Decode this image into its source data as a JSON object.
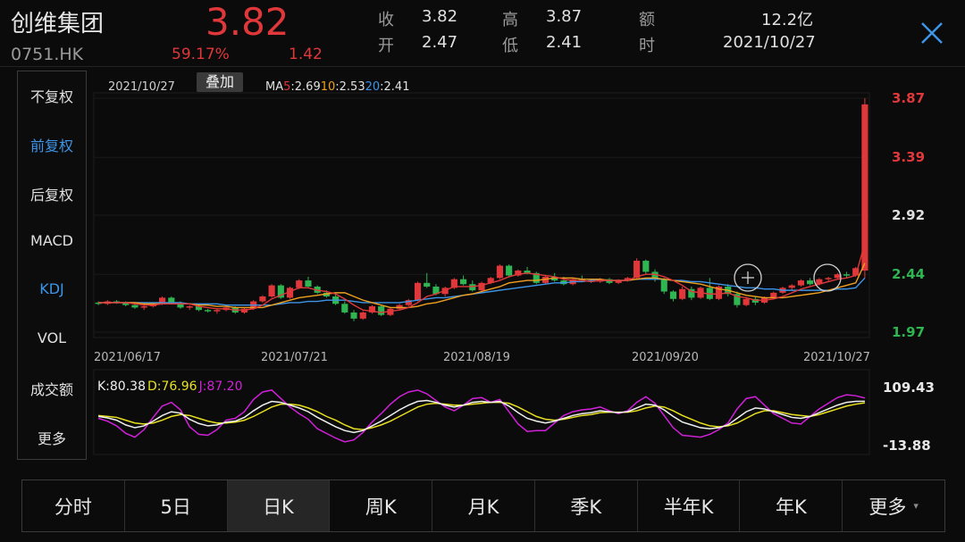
{
  "header": {
    "name": "创维集团",
    "code": "0751.HK",
    "price": "3.82",
    "change_pct": "59.17%",
    "change": "1.42",
    "quotes": [
      {
        "label": "收",
        "value": "3.82"
      },
      {
        "label": "开",
        "value": "2.47"
      },
      {
        "label": "高",
        "value": "3.87"
      },
      {
        "label": "低",
        "value": "2.41"
      },
      {
        "label": "额",
        "value": "12.2亿"
      },
      {
        "label": "时",
        "value": "2021/10/27"
      }
    ],
    "colors": {
      "up": "#e0383a",
      "down": "#2fb551",
      "accent": "#3d95e8",
      "background": "#0b0b0b"
    }
  },
  "left_menu": [
    {
      "label": "不复权",
      "active": false
    },
    {
      "label": "前复权",
      "active": true
    },
    {
      "label": "后复权",
      "active": false
    },
    {
      "label": "MACD",
      "active": false
    },
    {
      "label": "KDJ",
      "active": true
    },
    {
      "label": "VOL",
      "active": false
    },
    {
      "label": "成交额",
      "active": false
    },
    {
      "label": "更多",
      "active": false
    }
  ],
  "chart": {
    "date": "2021/10/27",
    "overlay_button": "叠加",
    "ma": [
      {
        "prefix": "MA",
        "period": "5",
        "value": ":2.69",
        "color": "#e0383a"
      },
      {
        "prefix": "",
        "period": "10",
        "value": ":2.53",
        "color": "#f0a020"
      },
      {
        "prefix": "",
        "period": "20",
        "value": ":2.41",
        "color": "#3d95e8"
      }
    ],
    "kdj_labels": {
      "k": "K:80.38",
      "d": "D:76.96",
      "j": "J:87.20"
    }
  },
  "chart_data": [
    {
      "type": "candlestick",
      "title": "",
      "x_labels": [
        "2021/06/17",
        "2021/07/21",
        "2021/08/19",
        "2021/09/20",
        "2021/10/27"
      ],
      "y_ticks": [
        "3.87",
        "3.39",
        "2.92",
        "2.44",
        "1.97"
      ],
      "ylim": [
        1.97,
        3.87
      ],
      "candles": [
        [
          2.21,
          2.22,
          2.19,
          2.2
        ],
        [
          2.2,
          2.23,
          2.19,
          2.22
        ],
        [
          2.22,
          2.23,
          2.2,
          2.21
        ],
        [
          2.21,
          2.22,
          2.18,
          2.19
        ],
        [
          2.19,
          2.2,
          2.16,
          2.17
        ],
        [
          2.17,
          2.19,
          2.15,
          2.18
        ],
        [
          2.18,
          2.21,
          2.17,
          2.2
        ],
        [
          2.2,
          2.26,
          2.19,
          2.25
        ],
        [
          2.25,
          2.26,
          2.2,
          2.21
        ],
        [
          2.21,
          2.22,
          2.16,
          2.17
        ],
        [
          2.17,
          2.19,
          2.15,
          2.18
        ],
        [
          2.18,
          2.2,
          2.14,
          2.15
        ],
        [
          2.15,
          2.16,
          2.13,
          2.14
        ],
        [
          2.14,
          2.16,
          2.12,
          2.15
        ],
        [
          2.15,
          2.18,
          2.14,
          2.17
        ],
        [
          2.17,
          2.18,
          2.12,
          2.13
        ],
        [
          2.13,
          2.17,
          2.12,
          2.16
        ],
        [
          2.16,
          2.23,
          2.15,
          2.22
        ],
        [
          2.22,
          2.27,
          2.21,
          2.26
        ],
        [
          2.26,
          2.36,
          2.25,
          2.35
        ],
        [
          2.35,
          2.36,
          2.24,
          2.25
        ],
        [
          2.25,
          2.34,
          2.24,
          2.33
        ],
        [
          2.33,
          2.4,
          2.32,
          2.39
        ],
        [
          2.39,
          2.42,
          2.33,
          2.34
        ],
        [
          2.34,
          2.35,
          2.28,
          2.29
        ],
        [
          2.29,
          2.31,
          2.25,
          2.26
        ],
        [
          2.26,
          2.28,
          2.19,
          2.2
        ],
        [
          2.2,
          2.22,
          2.12,
          2.13
        ],
        [
          2.13,
          2.15,
          2.06,
          2.08
        ],
        [
          2.08,
          2.14,
          2.07,
          2.13
        ],
        [
          2.13,
          2.19,
          2.12,
          2.18
        ],
        [
          2.18,
          2.19,
          2.1,
          2.11
        ],
        [
          2.11,
          2.17,
          2.1,
          2.16
        ],
        [
          2.16,
          2.2,
          2.15,
          2.19
        ],
        [
          2.19,
          2.24,
          2.18,
          2.23
        ],
        [
          2.23,
          2.38,
          2.22,
          2.37
        ],
        [
          2.37,
          2.45,
          2.33,
          2.34
        ],
        [
          2.34,
          2.36,
          2.27,
          2.28
        ],
        [
          2.28,
          2.34,
          2.26,
          2.33
        ],
        [
          2.33,
          2.41,
          2.32,
          2.4
        ],
        [
          2.4,
          2.43,
          2.35,
          2.36
        ],
        [
          2.36,
          2.39,
          2.3,
          2.31
        ],
        [
          2.31,
          2.38,
          2.3,
          2.37
        ],
        [
          2.37,
          2.42,
          2.36,
          2.41
        ],
        [
          2.41,
          2.52,
          2.4,
          2.51
        ],
        [
          2.51,
          2.52,
          2.42,
          2.43
        ],
        [
          2.43,
          2.48,
          2.42,
          2.47
        ],
        [
          2.47,
          2.5,
          2.44,
          2.45
        ],
        [
          2.45,
          2.46,
          2.36,
          2.37
        ],
        [
          2.37,
          2.43,
          2.36,
          2.42
        ],
        [
          2.42,
          2.45,
          2.38,
          2.39
        ],
        [
          2.39,
          2.42,
          2.35,
          2.36
        ],
        [
          2.36,
          2.41,
          2.35,
          2.4
        ],
        [
          2.4,
          2.43,
          2.38,
          2.39
        ],
        [
          2.39,
          2.4,
          2.37,
          2.38
        ],
        [
          2.38,
          2.41,
          2.37,
          2.4
        ],
        [
          2.4,
          2.41,
          2.36,
          2.37
        ],
        [
          2.37,
          2.4,
          2.36,
          2.39
        ],
        [
          2.39,
          2.42,
          2.38,
          2.41
        ],
        [
          2.41,
          2.57,
          2.4,
          2.55
        ],
        [
          2.55,
          2.56,
          2.44,
          2.46
        ],
        [
          2.46,
          2.48,
          2.38,
          2.4
        ],
        [
          2.4,
          2.41,
          2.28,
          2.3
        ],
        [
          2.3,
          2.31,
          2.22,
          2.24
        ],
        [
          2.24,
          2.34,
          2.23,
          2.32
        ],
        [
          2.32,
          2.34,
          2.23,
          2.25
        ],
        [
          2.25,
          2.34,
          2.24,
          2.33
        ],
        [
          2.33,
          2.41,
          2.23,
          2.24
        ],
        [
          2.24,
          2.35,
          2.23,
          2.34
        ],
        [
          2.34,
          2.36,
          2.26,
          2.28
        ],
        [
          2.28,
          2.3,
          2.17,
          2.19
        ],
        [
          2.19,
          2.25,
          2.18,
          2.24
        ],
        [
          2.24,
          2.26,
          2.19,
          2.21
        ],
        [
          2.21,
          2.26,
          2.2,
          2.25
        ],
        [
          2.25,
          2.3,
          2.24,
          2.29
        ],
        [
          2.29,
          2.34,
          2.28,
          2.33
        ],
        [
          2.33,
          2.36,
          2.31,
          2.35
        ],
        [
          2.35,
          2.4,
          2.34,
          2.39
        ],
        [
          2.39,
          2.41,
          2.35,
          2.36
        ],
        [
          2.36,
          2.41,
          2.35,
          2.4
        ],
        [
          2.4,
          2.42,
          2.38,
          2.41
        ],
        [
          2.41,
          2.45,
          2.4,
          2.44
        ],
        [
          2.44,
          2.46,
          2.41,
          2.43
        ],
        [
          2.43,
          2.5,
          2.42,
          2.49
        ],
        [
          2.47,
          3.87,
          2.41,
          3.82
        ]
      ],
      "ma5": [
        2.21,
        2.21,
        2.21,
        2.21,
        2.2,
        2.19,
        2.19,
        2.2,
        2.2,
        2.2,
        2.2,
        2.18,
        2.17,
        2.16,
        2.16,
        2.15,
        2.15,
        2.16,
        2.19,
        2.24,
        2.27,
        2.3,
        2.33,
        2.33,
        2.31,
        2.3,
        2.28,
        2.24,
        2.19,
        2.15,
        2.14,
        2.13,
        2.14,
        2.15,
        2.17,
        2.21,
        2.26,
        2.28,
        2.31,
        2.34,
        2.34,
        2.34,
        2.35,
        2.37,
        2.39,
        2.42,
        2.44,
        2.45,
        2.44,
        2.43,
        2.42,
        2.4,
        2.39,
        2.39,
        2.38,
        2.39,
        2.39,
        2.39,
        2.39,
        2.42,
        2.44,
        2.44,
        2.42,
        2.39,
        2.35,
        2.3,
        2.29,
        2.28,
        2.28,
        2.29,
        2.26,
        2.25,
        2.23,
        2.23,
        2.24,
        2.26,
        2.29,
        2.32,
        2.34,
        2.36,
        2.38,
        2.4,
        2.41,
        2.43,
        2.69
      ],
      "ma10": [
        2.21,
        2.21,
        2.21,
        2.21,
        2.21,
        2.2,
        2.2,
        2.2,
        2.2,
        2.2,
        2.2,
        2.19,
        2.19,
        2.18,
        2.18,
        2.17,
        2.17,
        2.17,
        2.17,
        2.19,
        2.21,
        2.23,
        2.25,
        2.26,
        2.27,
        2.28,
        2.29,
        2.29,
        2.26,
        2.23,
        2.21,
        2.19,
        2.17,
        2.17,
        2.17,
        2.18,
        2.2,
        2.21,
        2.23,
        2.25,
        2.27,
        2.28,
        2.3,
        2.32,
        2.34,
        2.37,
        2.38,
        2.39,
        2.39,
        2.4,
        2.41,
        2.41,
        2.41,
        2.4,
        2.4,
        2.4,
        2.39,
        2.39,
        2.39,
        2.4,
        2.41,
        2.41,
        2.4,
        2.39,
        2.38,
        2.37,
        2.36,
        2.34,
        2.32,
        2.31,
        2.29,
        2.27,
        2.26,
        2.25,
        2.25,
        2.25,
        2.26,
        2.27,
        2.28,
        2.29,
        2.31,
        2.33,
        2.35,
        2.37,
        2.53
      ],
      "ma20": [
        2.21,
        2.21,
        2.21,
        2.21,
        2.21,
        2.21,
        2.21,
        2.21,
        2.21,
        2.21,
        2.2,
        2.2,
        2.2,
        2.2,
        2.19,
        2.19,
        2.19,
        2.19,
        2.19,
        2.19,
        2.2,
        2.21,
        2.21,
        2.22,
        2.22,
        2.23,
        2.23,
        2.23,
        2.22,
        2.21,
        2.21,
        2.21,
        2.21,
        2.21,
        2.22,
        2.23,
        2.24,
        2.25,
        2.25,
        2.26,
        2.27,
        2.28,
        2.29,
        2.3,
        2.31,
        2.32,
        2.33,
        2.34,
        2.35,
        2.36,
        2.37,
        2.37,
        2.38,
        2.38,
        2.39,
        2.39,
        2.39,
        2.39,
        2.39,
        2.4,
        2.4,
        2.4,
        2.4,
        2.39,
        2.39,
        2.38,
        2.38,
        2.37,
        2.36,
        2.35,
        2.34,
        2.33,
        2.33,
        2.32,
        2.32,
        2.31,
        2.31,
        2.31,
        2.31,
        2.31,
        2.31,
        2.32,
        2.32,
        2.33,
        2.41
      ]
    },
    {
      "type": "line",
      "title": "KDJ",
      "y_ticks": [
        "109.43",
        "-13.88"
      ],
      "ylim": [
        -13.88,
        109.43
      ],
      "series": [
        {
          "name": "K",
          "color": "#f0f0f0",
          "values": [
            48,
            45,
            40,
            30,
            24,
            28,
            38,
            50,
            58,
            55,
            42,
            33,
            28,
            30,
            36,
            38,
            46,
            60,
            72,
            80,
            78,
            72,
            66,
            58,
            46,
            36,
            26,
            18,
            14,
            18,
            28,
            38,
            50,
            62,
            72,
            80,
            82,
            78,
            72,
            68,
            72,
            78,
            80,
            78,
            80,
            70,
            56,
            44,
            38,
            34,
            38,
            44,
            50,
            54,
            56,
            60,
            58,
            56,
            58,
            66,
            74,
            72,
            62,
            48,
            36,
            30,
            24,
            22,
            24,
            30,
            44,
            58,
            66,
            64,
            58,
            52,
            46,
            44,
            48,
            56,
            64,
            72,
            78,
            80,
            80.38
          ]
        },
        {
          "name": "D",
          "color": "#e8e020",
          "values": [
            50,
            48,
            46,
            40,
            34,
            32,
            34,
            40,
            48,
            52,
            50,
            44,
            38,
            34,
            34,
            36,
            40,
            48,
            58,
            68,
            74,
            74,
            72,
            66,
            58,
            48,
            40,
            30,
            22,
            20,
            24,
            30,
            38,
            48,
            58,
            68,
            74,
            76,
            74,
            72,
            72,
            74,
            76,
            78,
            78,
            76,
            68,
            58,
            48,
            42,
            40,
            42,
            46,
            50,
            52,
            56,
            57,
            57,
            57,
            60,
            66,
            70,
            68,
            60,
            50,
            42,
            34,
            28,
            26,
            28,
            34,
            44,
            54,
            60,
            60,
            56,
            52,
            50,
            48,
            52,
            58,
            64,
            70,
            74,
            76.96
          ]
        },
        {
          "name": "J",
          "color": "#d020d8",
          "values": [
            44,
            38,
            28,
            12,
            4,
            20,
            46,
            70,
            78,
            62,
            26,
            10,
            8,
            20,
            40,
            44,
            58,
            84,
            100,
            104,
            86,
            68,
            54,
            42,
            22,
            12,
            2,
            -6,
            -2,
            14,
            36,
            54,
            74,
            90,
            100,
            104,
            96,
            82,
            68,
            60,
            72,
            86,
            88,
            78,
            84,
            58,
            32,
            16,
            18,
            18,
            34,
            50,
            58,
            62,
            64,
            68,
            60,
            54,
            60,
            78,
            90,
            76,
            50,
            24,
            8,
            6,
            4,
            10,
            20,
            34,
            64,
            86,
            90,
            72,
            54,
            44,
            34,
            32,
            48,
            64,
            76,
            88,
            94,
            92,
            87.2
          ]
        }
      ]
    }
  ],
  "tabs": [
    {
      "label": "分时",
      "active": false
    },
    {
      "label": "5日",
      "active": false
    },
    {
      "label": "日K",
      "active": true
    },
    {
      "label": "周K",
      "active": false
    },
    {
      "label": "月K",
      "active": false
    },
    {
      "label": "季K",
      "active": false
    },
    {
      "label": "半年K",
      "active": false
    },
    {
      "label": "年K",
      "active": false
    },
    {
      "label": "更多",
      "active": false,
      "arrow": "▾"
    }
  ]
}
